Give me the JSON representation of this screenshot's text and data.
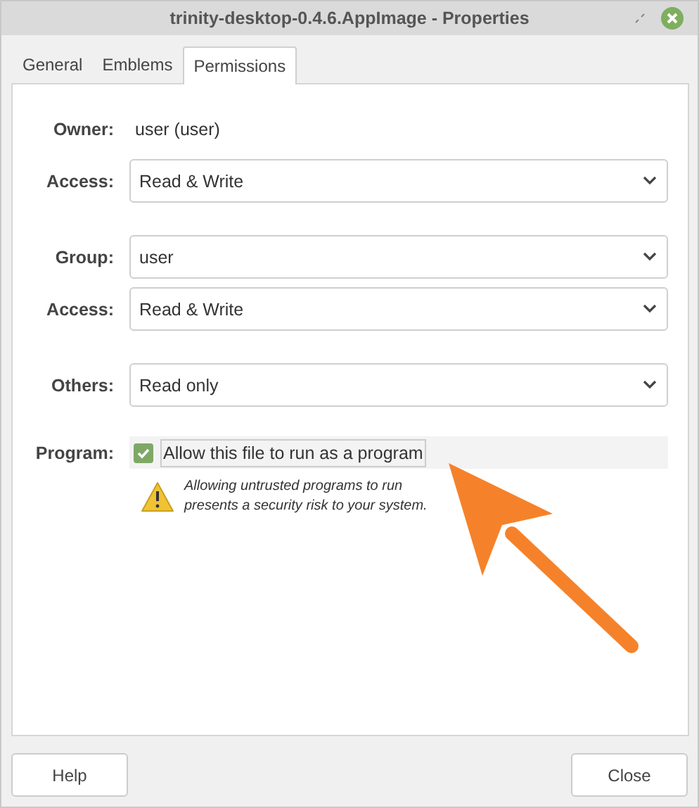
{
  "window": {
    "title": "trinity-desktop-0.4.6.AppImage - Properties"
  },
  "tabs": [
    {
      "label": "General",
      "selected": false
    },
    {
      "label": "Emblems",
      "selected": false
    },
    {
      "label": "Permissions",
      "selected": true
    }
  ],
  "groups": [
    [
      {
        "label": "Owner:",
        "kind": "text",
        "value": "user (user)"
      },
      {
        "label": "Access:",
        "kind": "dropdown",
        "value": "Read & Write"
      }
    ],
    [
      {
        "label": "Group:",
        "kind": "dropdown",
        "value": "user"
      },
      {
        "label": "Access:",
        "kind": "dropdown",
        "value": "Read & Write"
      }
    ],
    [
      {
        "label": "Others:",
        "kind": "dropdown",
        "value": "Read only"
      }
    ]
  ],
  "program": {
    "label": "Program:",
    "checkbox": "Allow this file to run as a program",
    "checked": true,
    "warning": "Allowing untrusted programs to run presents a security risk to your system."
  },
  "buttons": [
    "Help",
    "Close"
  ]
}
